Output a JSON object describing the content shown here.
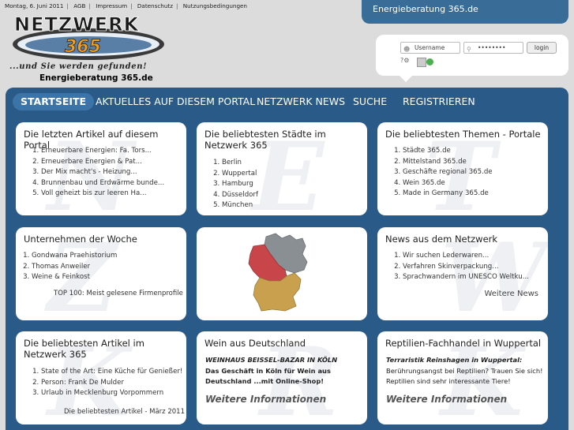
{
  "topbar": {
    "date": "Montag, 6. Juni 2011",
    "links": [
      "AGB",
      "Impressum",
      "Datenschutz",
      "Nutzungsbedingungen"
    ]
  },
  "brand": {
    "logo_text": "NETZWERK",
    "logo_number": "365",
    "tagline": "...und Sie werden gefunden!",
    "subtitle": "Energieberatung 365.de",
    "site_tab": "Energieberatung 365.de"
  },
  "login": {
    "username_placeholder": "Username",
    "password_value": "••••••••",
    "button": "login"
  },
  "nav": {
    "items": [
      "STARTSEITE",
      "AKTUELLES AUF DIESEM PORTAL",
      "NETZWERK NEWS",
      "SUCHE",
      "REGISTRIEREN"
    ]
  },
  "cards": {
    "articles": {
      "title": "Die letzten Artikel auf diesem Portal",
      "items": [
        "Erneuerbare Energien: Fa. Tors...",
        "Erneuerbare Energien & Pat...",
        "Der Mix macht's - Heizung...",
        "Brunnenbau und Erdwärme bunde...",
        "Voll geheizt bis zur leeren Ha..."
      ]
    },
    "cities": {
      "title": "Die beliebtesten Städte im Netzwerk 365",
      "items": [
        "Berlin",
        "Wuppertal",
        "Hamburg",
        "Düsseldorf",
        "München"
      ]
    },
    "themes": {
      "title": "Die beliebtesten Themen - Portale",
      "items": [
        "Städte 365.de",
        "Mittelstand 365.de",
        "Geschäfte regional 365.de",
        "Wein 365.de",
        "Made in Germany 365.de"
      ]
    },
    "companies": {
      "title": "Unternehmen der Woche",
      "items": [
        "Gondwana Praehistorium",
        "Thomas Anweiler",
        "Weine & Feinkost"
      ],
      "footer": "TOP 100: Meist gelesene Firmenprofile"
    },
    "news": {
      "title": "News aus dem Netzwerk",
      "items": [
        "Wir suchen Lederwaren...",
        "Verfahren Skinverpackung...",
        "Sprachwandern im UNESCO Weltku..."
      ],
      "more": "Weitere News"
    },
    "popular": {
      "title": "Die beliebtesten Artikel im Netzwerk 365",
      "items": [
        "State of the Art: Eine Küche für Genießer!",
        "Person: Frank De Mulder",
        "Urlaub in Mecklenburg Vorpommern"
      ],
      "footer": "Die beliebtesten Artikel - März 2011"
    },
    "wine": {
      "title": "Wein aus Deutschland",
      "headline": "WEINHAUS BEISSEL-BAZAR IN KÖLN",
      "line1": "Das Geschäft in Köln für Wein aus",
      "line2": "Deutschland ...mit Online-Shop!",
      "more": "Weitere Informationen"
    },
    "reptiles": {
      "title": "Reptilien-Fachhandel in Wuppertal",
      "headline": "Terraristik Reinshagen in Wuppertal:",
      "line1": "Berührungsangst bei Reptilien? Trauen Sie sich!",
      "line2": "Reptilien sind sehr interessante Tiere!",
      "more": "Weitere Informationen"
    }
  },
  "colors": {
    "main_bg": "#2a5a87",
    "nav_active": "#3d74a7",
    "site_tab": "#3a6c98",
    "map_west": "#c8454a",
    "map_east": "#8a8f94",
    "map_south": "#c9a14e"
  }
}
